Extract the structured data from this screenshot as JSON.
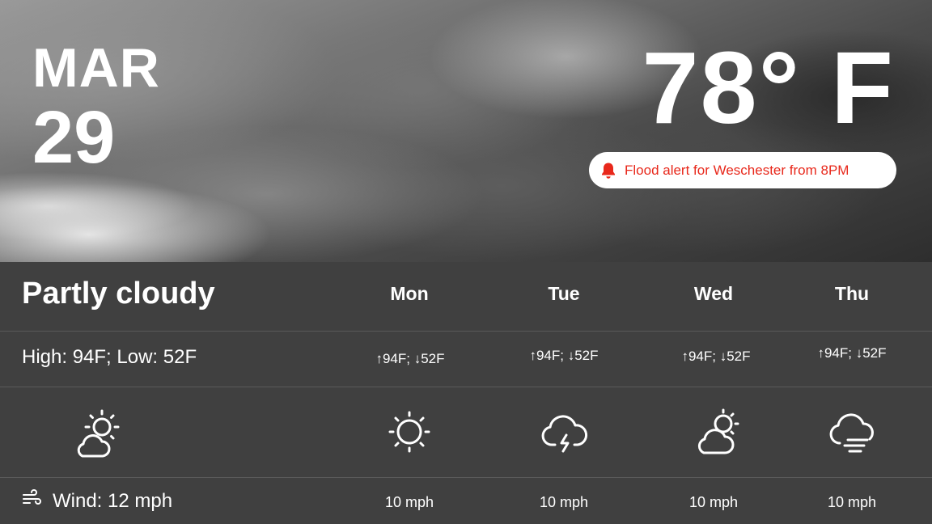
{
  "date": {
    "month": "MAR",
    "day": "29"
  },
  "current": {
    "temperature": "78° F",
    "condition": "Partly cloudy",
    "hilo": "High: 94F; Low: 52F",
    "wind": "Wind: 12 mph",
    "icon": "partly-cloudy-icon"
  },
  "alert": {
    "text": "Flood alert for Weschester from 8PM",
    "color": "#e8281b",
    "icon": "bell-icon"
  },
  "forecast": [
    {
      "day": "Mon",
      "hilo": "↑94F; ↓52F",
      "icon": "sun-icon",
      "wind": "10 mph"
    },
    {
      "day": "Tue",
      "hilo": "↑94F; ↓52F",
      "icon": "thunderstorm-icon",
      "wind": "10 mph"
    },
    {
      "day": "Wed",
      "hilo": "↑94F; ↓52F",
      "icon": "partly-cloudy-icon",
      "wind": "10 mph"
    },
    {
      "day": "Thu",
      "hilo": "↑94F; ↓52F",
      "icon": "fog-icon",
      "wind": "10 mph"
    }
  ]
}
